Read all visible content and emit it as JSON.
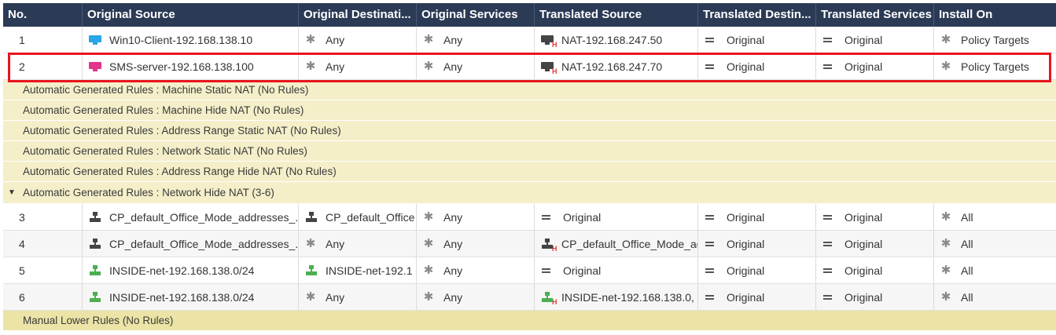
{
  "columns": [
    "No.",
    "Original Source",
    "Original Destinati...",
    "Original Services",
    "Translated Source",
    "Translated Destin...",
    "Translated Services",
    "Install On"
  ],
  "rules_top": [
    {
      "no": "1",
      "src": "Win10-Client-192.168.138.10",
      "dst": "Any",
      "svc": "Any",
      "tsrc": "NAT-192.168.247.50",
      "tdst": "Original",
      "tsvc": "Original",
      "install": "Policy Targets"
    },
    {
      "no": "2",
      "src": "SMS-server-192.168.138.100",
      "dst": "Any",
      "svc": "Any",
      "tsrc": "NAT-192.168.247.70",
      "tdst": "Original",
      "tsvc": "Original",
      "install": "Policy Targets"
    }
  ],
  "sections": [
    "Automatic Generated Rules : Machine Static NAT (No Rules)",
    "Automatic Generated Rules : Machine Hide NAT (No Rules)",
    "Automatic Generated Rules : Address Range Static NAT (No Rules)",
    "Automatic Generated Rules : Network Static NAT (No Rules)",
    "Automatic Generated Rules : Address Range Hide NAT (No Rules)",
    "Automatic Generated Rules : Network Hide NAT (3-6)"
  ],
  "rules_auto": [
    {
      "no": "3",
      "src": "CP_default_Office_Mode_addresses_...",
      "dst": "CP_default_Office",
      "svc": "Any",
      "tsrc": "Original",
      "tdst": "Original",
      "tsvc": "Original",
      "install": "All"
    },
    {
      "no": "4",
      "src": "CP_default_Office_Mode_addresses_...",
      "dst": "Any",
      "svc": "Any",
      "tsrc": "CP_default_Office_Mode_ad",
      "tdst": "Original",
      "tsvc": "Original",
      "install": "All"
    },
    {
      "no": "5",
      "src": "INSIDE-net-192.168.138.0/24",
      "dst": "INSIDE-net-192.1",
      "svc": "Any",
      "tsrc": "Original",
      "tdst": "Original",
      "tsvc": "Original",
      "install": "All"
    },
    {
      "no": "6",
      "src": "INSIDE-net-192.168.138.0/24",
      "dst": "Any",
      "svc": "Any",
      "tsrc": "INSIDE-net-192.168.138.0,",
      "tdst": "Original",
      "tsvc": "Original",
      "install": "All"
    }
  ],
  "lower": "Manual Lower Rules (No Rules)",
  "hide_marker": "H",
  "colors": {
    "header_bg": "#2b3a55",
    "section_bg": "#f4efc9",
    "highlight": "#e8151d"
  }
}
